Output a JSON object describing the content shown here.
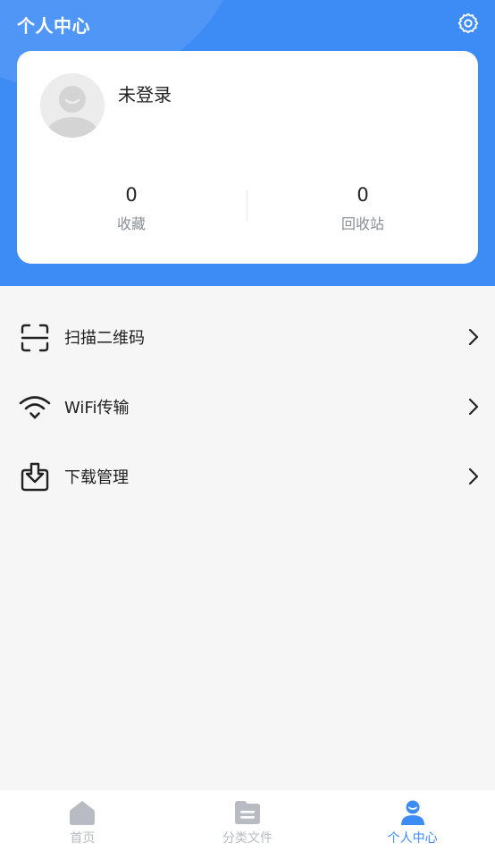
{
  "header": {
    "title": "个人中心",
    "settings_icon": "gear-icon"
  },
  "profile": {
    "avatar_icon": "default-avatar-icon",
    "username": "未登录",
    "stats": [
      {
        "value": "0",
        "label": "收藏"
      },
      {
        "value": "0",
        "label": "回收站"
      }
    ]
  },
  "menu": [
    {
      "label": "扫描二维码",
      "icon": "scan-icon"
    },
    {
      "label": "WiFi传输",
      "icon": "wifi-icon"
    },
    {
      "label": "下载管理",
      "icon": "download-box-icon"
    }
  ],
  "tabbar": {
    "tabs": [
      {
        "label": "首页",
        "icon": "home-icon",
        "active": false
      },
      {
        "label": "分类文件",
        "icon": "folder-icon",
        "active": false
      },
      {
        "label": "个人中心",
        "icon": "user-icon",
        "active": true
      }
    ]
  },
  "colors": {
    "accent": "#3d8bf5",
    "inactive_tab": "#b8bcc2",
    "background": "#f6f6f6"
  }
}
